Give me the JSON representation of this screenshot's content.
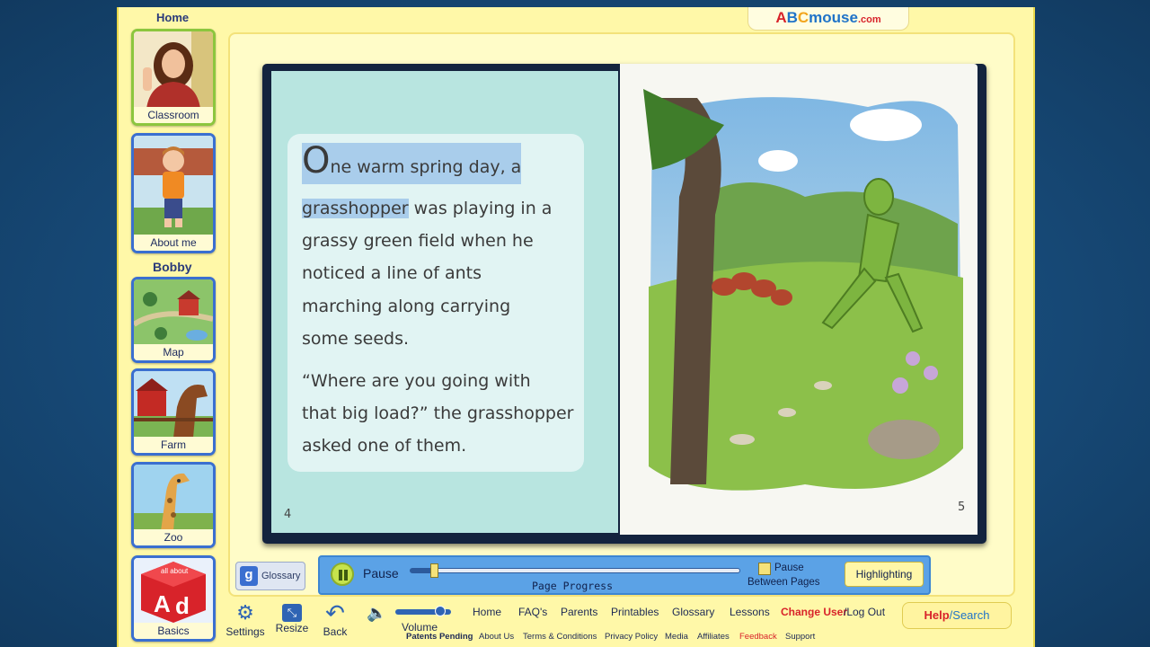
{
  "nav": {
    "home_label": "Home",
    "user_name": "Bobby",
    "tiles": [
      {
        "label": "Classroom"
      },
      {
        "label": "About me"
      },
      {
        "label": "Map"
      },
      {
        "label": "Farm"
      },
      {
        "label": "Zoo"
      },
      {
        "label": "Basics"
      }
    ],
    "basics_badge": "all about"
  },
  "logo": {
    "text_a": "A",
    "text_b": "B",
    "text_c": "C",
    "text_rest": "mouse",
    "domain": ".com"
  },
  "book": {
    "lines": [
      "One warm spring day, a",
      "grasshopper was playing in a",
      "grassy green field when he",
      "noticed a line of ants",
      "marching along carrying",
      "some seeds.",
      "“Where are you going with",
      "that big load?” the grasshopper",
      "asked one of them."
    ],
    "highlight_1": "ne warm spring day, a",
    "drop_cap": "O",
    "highlight_2": "grasshopper",
    "line2_rest": " was playing in a",
    "left_page_number": "4",
    "right_page_number": "5"
  },
  "controls": {
    "glossary_icon": "g",
    "glossary_label": "Glossary",
    "pause_label": "Pause",
    "progress_label": "Page Progress",
    "progress_value": 0.07,
    "pause_between_line1": "Pause",
    "pause_between_line2": "Between Pages",
    "highlighting_label": "Highlighting"
  },
  "toolbar": {
    "settings": "Settings",
    "resize": "Resize",
    "back": "Back",
    "volume": "Volume",
    "volume_level": 0.8
  },
  "bottom_nav": {
    "links": [
      "Home",
      "FAQ's",
      "Parents",
      "Printables",
      "Glossary",
      "Lessons"
    ],
    "change_user": "Change User",
    "logout": "/Log Out",
    "help": "Help",
    "search": "/Search"
  },
  "footer": {
    "patents": "Patents Pending",
    "links": [
      "About Us",
      "Terms & Conditions",
      "Privacy Policy",
      "Media",
      "Affiliates",
      "Feedback",
      "Support"
    ]
  },
  "colors": {
    "accent_red": "#d8232a",
    "nav_blue": "#3a6fd0",
    "ctrl_blue": "#5ba2e6",
    "highlight": "#a9cdeb"
  }
}
